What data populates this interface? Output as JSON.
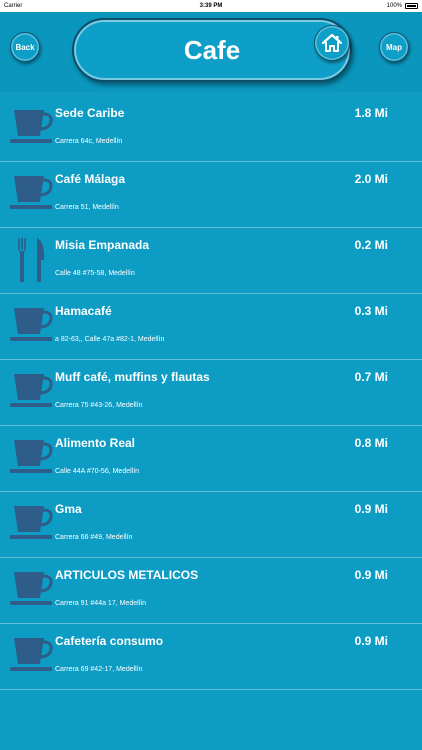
{
  "status_bar": {
    "carrier": "Carrier",
    "time": "3:39 PM",
    "battery": "100%"
  },
  "header": {
    "back_label": "Back",
    "title": "Cafe",
    "map_label": "Map",
    "home_icon": "home-icon"
  },
  "colors": {
    "background": "#0c9cc4",
    "icon": "#2f5d89",
    "text": "#ffffff"
  },
  "places": [
    {
      "name": "Sede Caribe",
      "address": "Carrera 64c, Medellín",
      "distance": "1.8 Mi",
      "icon": "coffee-cup-icon"
    },
    {
      "name": "Café Málaga",
      "address": "Carrera 51, Medellín",
      "distance": "2.0 Mi",
      "icon": "coffee-cup-icon"
    },
    {
      "name": "Misia Empanada",
      "address": "Calle 48 #75-58, Medellín",
      "distance": "0.2 Mi",
      "icon": "fork-knife-icon"
    },
    {
      "name": "Hamacafé",
      "address": "a 82-63,, Calle 47a #82-1, Medellín",
      "distance": "0.3 Mi",
      "icon": "coffee-cup-icon"
    },
    {
      "name": "Muff café, muffins y flautas",
      "address": "Carrera 75 #43-26, Medellín",
      "distance": "0.7 Mi",
      "icon": "coffee-cup-icon"
    },
    {
      "name": "Alimento Real",
      "address": "Calle 44A #70-56, Medellín",
      "distance": "0.8 Mi",
      "icon": "coffee-cup-icon"
    },
    {
      "name": "Gma",
      "address": "Carrera 66 #49, Medellín",
      "distance": "0.9 Mi",
      "icon": "coffee-cup-icon"
    },
    {
      "name": "ARTICULOS METALICOS",
      "address": "Carrera 91 #44a 17, Medellín",
      "distance": "0.9 Mi",
      "icon": "coffee-cup-icon"
    },
    {
      "name": "Cafetería consumo",
      "address": "Carrera 69 #42-17, Medellín",
      "distance": "0.9 Mi",
      "icon": "coffee-cup-icon"
    }
  ]
}
